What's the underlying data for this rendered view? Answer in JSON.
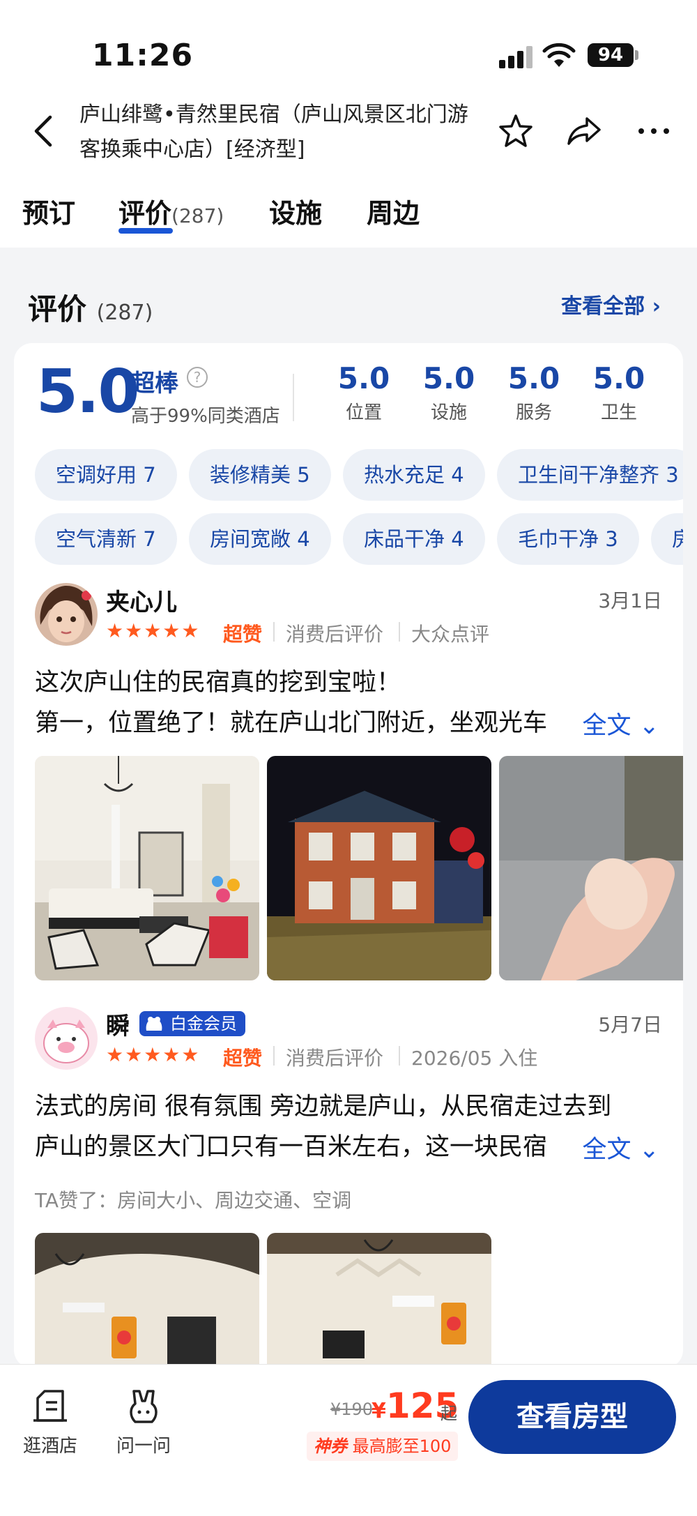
{
  "status_bar": {
    "time": "11:26",
    "battery": "94"
  },
  "header": {
    "title": "庐山绯鹭•青然里民宿（庐山风景区北门游客换乘中心店）[经济型]"
  },
  "tabs": [
    {
      "label": "预订",
      "count": ""
    },
    {
      "label": "评价",
      "count": "(287)"
    },
    {
      "label": "设施",
      "count": ""
    },
    {
      "label": "周边",
      "count": ""
    }
  ],
  "reviews_section": {
    "title": "评价",
    "count": "(287)",
    "see_all": "查看全部"
  },
  "rating": {
    "score": "5.0",
    "word": "超棒",
    "sub": "高于99%同类酒店",
    "subs": [
      {
        "value": "5.0",
        "label": "位置"
      },
      {
        "value": "5.0",
        "label": "设施"
      },
      {
        "value": "5.0",
        "label": "服务"
      },
      {
        "value": "5.0",
        "label": "卫生"
      }
    ]
  },
  "tags_row1": [
    "空调好用 7",
    "装修精美 5",
    "热水充足 4",
    "卫生间干净整齐 3"
  ],
  "tags_row2": [
    "空气清新 7",
    "房间宽敞 4",
    "床品干净 4",
    "毛巾干净 3",
    "房"
  ],
  "reviews": [
    {
      "user": "夹心儿",
      "date": "3月1日",
      "stars": 5,
      "rating_word": "超赞",
      "meta": [
        "消费后评价",
        "大众点评"
      ],
      "lines": [
        "这次庐山住的民宿真的挖到宝啦！",
        "第一，位置绝了！就在庐山北门附近，坐观光车"
      ],
      "more": "全文"
    },
    {
      "user": "瞬",
      "badge": "白金会员",
      "date": "5月7日",
      "stars": 5,
      "rating_word": "超赞",
      "meta": [
        "消费后评价",
        "2026/05 入住"
      ],
      "lines": [
        "法式的房间 很有氛围 旁边就是庐山，从民宿走过去到",
        "庐山的景区大门口只有一百米左右，这一块民宿"
      ],
      "more": "全文",
      "liked": "TA赞了：房间大小、周边交通、空调"
    }
  ],
  "bottom_bar": {
    "nav": [
      {
        "label": "逛酒店",
        "icon": "hotel-list-icon"
      },
      {
        "label": "问一问",
        "icon": "ask-rabbit-icon"
      }
    ],
    "price_original": "¥190",
    "price_symbol": "¥",
    "price": "125",
    "price_suffix": "起",
    "coupon_brand": "神券",
    "coupon_text": "最高膨至100",
    "cta": "查看房型"
  },
  "colors": {
    "accent": "#1947a6",
    "price": "#ff3b1f",
    "star": "#ff5a1f",
    "cta": "#0e3a9c"
  }
}
